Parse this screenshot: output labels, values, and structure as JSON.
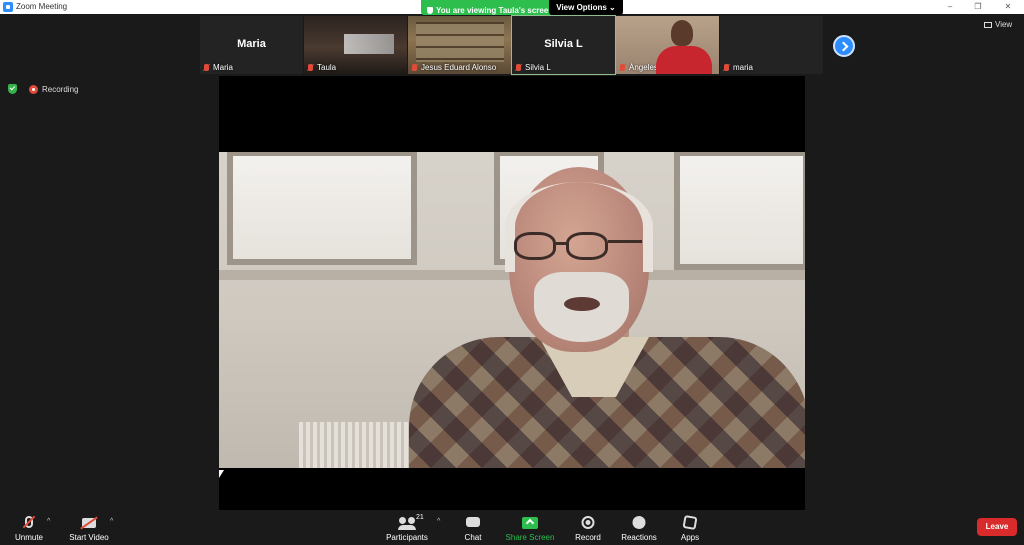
{
  "window": {
    "title": "Zoom Meeting",
    "minimize": "–",
    "restore": "❐",
    "close": "✕"
  },
  "share_banner": {
    "text": "You are viewing Taula's screen",
    "view_options": "View Options ⌄"
  },
  "view_button": "View",
  "recording": "Recording",
  "gallery": [
    {
      "name": "Maria",
      "big_name": "Maria",
      "video": false
    },
    {
      "name": "Taula",
      "video": true
    },
    {
      "name": "Jesus Eduard Alonso",
      "video": true
    },
    {
      "name": "Silvia L",
      "big_name": "Silvia L",
      "video": false,
      "active": true
    },
    {
      "name": "Àngeles Open Arms",
      "video": true
    },
    {
      "name": "maria",
      "video": false
    }
  ],
  "toolbar": {
    "unmute": "Unmute",
    "start_video": "Start Video",
    "participants": "Participants",
    "participants_count": "21",
    "chat": "Chat",
    "share_screen": "Share Screen",
    "record": "Record",
    "reactions": "Reactions",
    "apps": "Apps",
    "leave": "Leave",
    "caret": "^"
  },
  "colors": {
    "accent": "#2d8cff",
    "share_green": "#2dbe4e",
    "leave_red": "#d92b2b",
    "muted_red": "#e04b3a"
  }
}
